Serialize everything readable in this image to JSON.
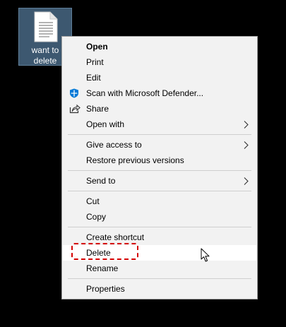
{
  "desktop": {
    "file_icon": "document-icon",
    "file_label_line1": "want to",
    "file_label_line2": "delete"
  },
  "context_menu": {
    "items": [
      {
        "label": "Open",
        "bold": true
      },
      {
        "label": "Print"
      },
      {
        "label": "Edit"
      },
      {
        "label": "Scan with Microsoft Defender...",
        "icon": "shield-icon"
      },
      {
        "label": "Share",
        "icon": "share-icon"
      },
      {
        "label": "Open with",
        "submenu": true
      },
      {
        "label": "Give access to",
        "submenu": true
      },
      {
        "label": "Restore previous versions"
      },
      {
        "label": "Send to",
        "submenu": true
      },
      {
        "label": "Cut"
      },
      {
        "label": "Copy"
      },
      {
        "label": "Create shortcut"
      },
      {
        "label": "Delete",
        "hovered": true,
        "annotated": true
      },
      {
        "label": "Rename"
      },
      {
        "label": "Properties"
      }
    ]
  },
  "annotation": {
    "color": "#d40000",
    "target": "Delete"
  },
  "colors": {
    "menu_bg": "#f2f2f2",
    "hover_bg": "#ffffff",
    "selected_icon_bg": "#3d5870",
    "defender_blue": "#0078d7"
  }
}
